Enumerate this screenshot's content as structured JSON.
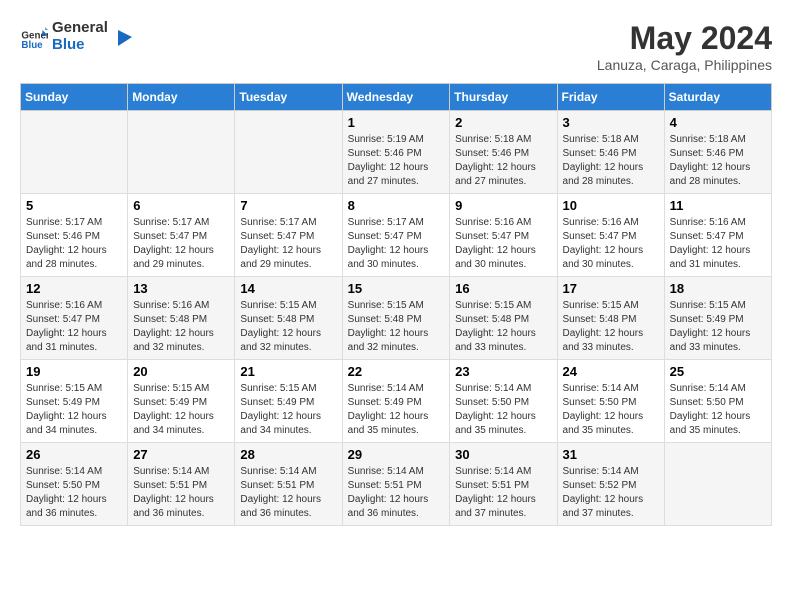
{
  "logo": {
    "text_general": "General",
    "text_blue": "Blue"
  },
  "header": {
    "month": "May 2024",
    "location": "Lanuza, Caraga, Philippines"
  },
  "weekdays": [
    "Sunday",
    "Monday",
    "Tuesday",
    "Wednesday",
    "Thursday",
    "Friday",
    "Saturday"
  ],
  "weeks": [
    [
      {
        "day": "",
        "info": ""
      },
      {
        "day": "",
        "info": ""
      },
      {
        "day": "",
        "info": ""
      },
      {
        "day": "1",
        "info": "Sunrise: 5:19 AM\nSunset: 5:46 PM\nDaylight: 12 hours\nand 27 minutes."
      },
      {
        "day": "2",
        "info": "Sunrise: 5:18 AM\nSunset: 5:46 PM\nDaylight: 12 hours\nand 27 minutes."
      },
      {
        "day": "3",
        "info": "Sunrise: 5:18 AM\nSunset: 5:46 PM\nDaylight: 12 hours\nand 28 minutes."
      },
      {
        "day": "4",
        "info": "Sunrise: 5:18 AM\nSunset: 5:46 PM\nDaylight: 12 hours\nand 28 minutes."
      }
    ],
    [
      {
        "day": "5",
        "info": "Sunrise: 5:17 AM\nSunset: 5:46 PM\nDaylight: 12 hours\nand 28 minutes."
      },
      {
        "day": "6",
        "info": "Sunrise: 5:17 AM\nSunset: 5:47 PM\nDaylight: 12 hours\nand 29 minutes."
      },
      {
        "day": "7",
        "info": "Sunrise: 5:17 AM\nSunset: 5:47 PM\nDaylight: 12 hours\nand 29 minutes."
      },
      {
        "day": "8",
        "info": "Sunrise: 5:17 AM\nSunset: 5:47 PM\nDaylight: 12 hours\nand 30 minutes."
      },
      {
        "day": "9",
        "info": "Sunrise: 5:16 AM\nSunset: 5:47 PM\nDaylight: 12 hours\nand 30 minutes."
      },
      {
        "day": "10",
        "info": "Sunrise: 5:16 AM\nSunset: 5:47 PM\nDaylight: 12 hours\nand 30 minutes."
      },
      {
        "day": "11",
        "info": "Sunrise: 5:16 AM\nSunset: 5:47 PM\nDaylight: 12 hours\nand 31 minutes."
      }
    ],
    [
      {
        "day": "12",
        "info": "Sunrise: 5:16 AM\nSunset: 5:47 PM\nDaylight: 12 hours\nand 31 minutes."
      },
      {
        "day": "13",
        "info": "Sunrise: 5:16 AM\nSunset: 5:48 PM\nDaylight: 12 hours\nand 32 minutes."
      },
      {
        "day": "14",
        "info": "Sunrise: 5:15 AM\nSunset: 5:48 PM\nDaylight: 12 hours\nand 32 minutes."
      },
      {
        "day": "15",
        "info": "Sunrise: 5:15 AM\nSunset: 5:48 PM\nDaylight: 12 hours\nand 32 minutes."
      },
      {
        "day": "16",
        "info": "Sunrise: 5:15 AM\nSunset: 5:48 PM\nDaylight: 12 hours\nand 33 minutes."
      },
      {
        "day": "17",
        "info": "Sunrise: 5:15 AM\nSunset: 5:48 PM\nDaylight: 12 hours\nand 33 minutes."
      },
      {
        "day": "18",
        "info": "Sunrise: 5:15 AM\nSunset: 5:49 PM\nDaylight: 12 hours\nand 33 minutes."
      }
    ],
    [
      {
        "day": "19",
        "info": "Sunrise: 5:15 AM\nSunset: 5:49 PM\nDaylight: 12 hours\nand 34 minutes."
      },
      {
        "day": "20",
        "info": "Sunrise: 5:15 AM\nSunset: 5:49 PM\nDaylight: 12 hours\nand 34 minutes."
      },
      {
        "day": "21",
        "info": "Sunrise: 5:15 AM\nSunset: 5:49 PM\nDaylight: 12 hours\nand 34 minutes."
      },
      {
        "day": "22",
        "info": "Sunrise: 5:14 AM\nSunset: 5:49 PM\nDaylight: 12 hours\nand 35 minutes."
      },
      {
        "day": "23",
        "info": "Sunrise: 5:14 AM\nSunset: 5:50 PM\nDaylight: 12 hours\nand 35 minutes."
      },
      {
        "day": "24",
        "info": "Sunrise: 5:14 AM\nSunset: 5:50 PM\nDaylight: 12 hours\nand 35 minutes."
      },
      {
        "day": "25",
        "info": "Sunrise: 5:14 AM\nSunset: 5:50 PM\nDaylight: 12 hours\nand 35 minutes."
      }
    ],
    [
      {
        "day": "26",
        "info": "Sunrise: 5:14 AM\nSunset: 5:50 PM\nDaylight: 12 hours\nand 36 minutes."
      },
      {
        "day": "27",
        "info": "Sunrise: 5:14 AM\nSunset: 5:51 PM\nDaylight: 12 hours\nand 36 minutes."
      },
      {
        "day": "28",
        "info": "Sunrise: 5:14 AM\nSunset: 5:51 PM\nDaylight: 12 hours\nand 36 minutes."
      },
      {
        "day": "29",
        "info": "Sunrise: 5:14 AM\nSunset: 5:51 PM\nDaylight: 12 hours\nand 36 minutes."
      },
      {
        "day": "30",
        "info": "Sunrise: 5:14 AM\nSunset: 5:51 PM\nDaylight: 12 hours\nand 37 minutes."
      },
      {
        "day": "31",
        "info": "Sunrise: 5:14 AM\nSunset: 5:52 PM\nDaylight: 12 hours\nand 37 minutes."
      },
      {
        "day": "",
        "info": ""
      }
    ]
  ]
}
